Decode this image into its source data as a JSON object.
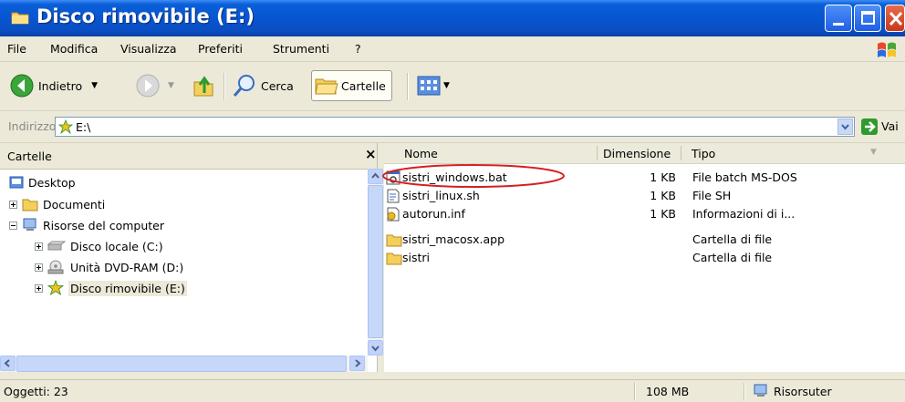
{
  "window": {
    "title": "Disco rimovibile (E:)"
  },
  "menu": [
    "File",
    "Modifica",
    "Visualizza",
    "Preferiti",
    "Strumenti",
    "?"
  ],
  "toolbar": {
    "back_label": "Indietro",
    "search_label": "Cerca",
    "folders_label": "Cartelle"
  },
  "address": {
    "label": "Indirizzo",
    "value": "E:\\",
    "go_label": "Vai"
  },
  "folders_pane": {
    "title": "Cartelle",
    "close_symbol": "×",
    "tree": [
      {
        "label": "Desktop",
        "icon": "desktop-icon"
      },
      {
        "label": "Documenti",
        "icon": "folder-icon"
      },
      {
        "label": "Risorse del computer",
        "icon": "computer-icon"
      },
      {
        "label": "Disco locale (C:)",
        "icon": "hard-drive-icon"
      },
      {
        "label": "Unità DVD-RAM (D:)",
        "icon": "dvd-drive-icon"
      },
      {
        "label": "Disco rimovibile (E:)",
        "icon": "removable-disk-icon",
        "selected": true
      }
    ]
  },
  "file_list": {
    "columns": [
      "Nome",
      "Dimensione",
      "Tipo"
    ],
    "rows": [
      {
        "name": "sistri_windows.bat",
        "size": "1 KB",
        "type": "File batch MS-DOS",
        "icon": "batch-file-icon",
        "highlighted": true
      },
      {
        "name": "sistri_linux.sh",
        "size": "1 KB",
        "type": "File SH",
        "icon": "text-file-icon"
      },
      {
        "name": "autorun.inf",
        "size": "1 KB",
        "type": "Informazioni di i...",
        "icon": "inf-file-icon"
      },
      {
        "name": "sistri_macosx.app",
        "size": "",
        "type": "Cartella di file",
        "icon": "folder-icon"
      },
      {
        "name": "sistri",
        "size": "",
        "type": "Cartella di file",
        "icon": "folder-icon"
      }
    ],
    "highlight_color": "#d42020"
  },
  "status": {
    "objects": "Oggetti: 23",
    "size": "108 MB",
    "location": "Risorsuter"
  },
  "colors": {
    "titlebar": "#0854d0",
    "chrome": "#ece9d8",
    "go_green": "#2f9b2f"
  }
}
